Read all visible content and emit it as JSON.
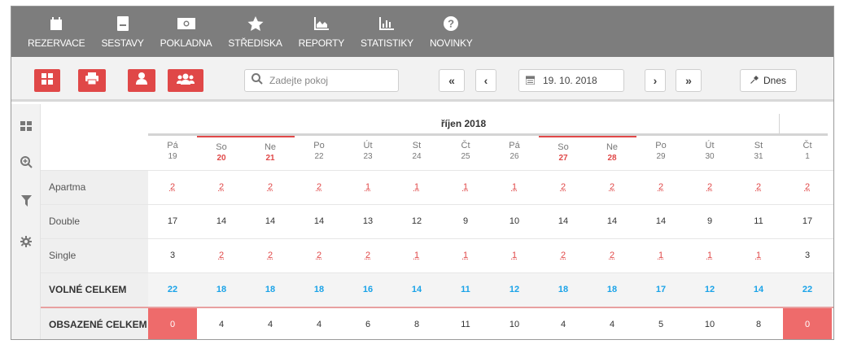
{
  "nav": [
    {
      "label": "REZERVACE",
      "icon": "calendar-icon"
    },
    {
      "label": "SESTAVY",
      "icon": "report-sheet-icon"
    },
    {
      "label": "POKLADNA",
      "icon": "cash-icon"
    },
    {
      "label": "STŘEDISKA",
      "icon": "star-icon"
    },
    {
      "label": "REPORTY",
      "icon": "area-chart-icon"
    },
    {
      "label": "STATISTIKY",
      "icon": "bar-chart-icon"
    },
    {
      "label": "NOVINKY",
      "icon": "question-icon"
    }
  ],
  "toolbar": {
    "search_placeholder": "Zadejte pokoj",
    "date_value": "19. 10. 2018",
    "today_label": "Dnes",
    "first_label": "«",
    "prev_label": "‹",
    "next_label": "›",
    "last_label": "»"
  },
  "grid": {
    "month": "říjen 2018",
    "days": [
      {
        "name": "Pá",
        "num": "19",
        "weekend": false
      },
      {
        "name": "So",
        "num": "20",
        "weekend": true
      },
      {
        "name": "Ne",
        "num": "21",
        "weekend": true
      },
      {
        "name": "Po",
        "num": "22",
        "weekend": false
      },
      {
        "name": "Út",
        "num": "23",
        "weekend": false
      },
      {
        "name": "St",
        "num": "24",
        "weekend": false
      },
      {
        "name": "Čt",
        "num": "25",
        "weekend": false
      },
      {
        "name": "Pá",
        "num": "26",
        "weekend": false
      },
      {
        "name": "So",
        "num": "27",
        "weekend": true
      },
      {
        "name": "Ne",
        "num": "28",
        "weekend": true
      },
      {
        "name": "Po",
        "num": "29",
        "weekend": false
      },
      {
        "name": "Út",
        "num": "30",
        "weekend": false
      },
      {
        "name": "St",
        "num": "31",
        "weekend": false
      },
      {
        "name": "Čt",
        "num": "1",
        "weekend": false
      }
    ],
    "rows": [
      {
        "label": "Apartma",
        "style": "red",
        "values": [
          "2",
          "2",
          "2",
          "2",
          "1",
          "1",
          "1",
          "1",
          "2",
          "2",
          "2",
          "2",
          "2",
          "2"
        ]
      },
      {
        "label": "Double",
        "style": "plain",
        "values": [
          "17",
          "14",
          "14",
          "14",
          "13",
          "12",
          "9",
          "10",
          "14",
          "14",
          "14",
          "9",
          "11",
          "17"
        ]
      },
      {
        "label": "Single",
        "style": "mixed",
        "values": [
          "3",
          "2",
          "2",
          "2",
          "2",
          "1",
          "1",
          "1",
          "2",
          "2",
          "1",
          "1",
          "1",
          "3"
        ],
        "red_mask": [
          false,
          true,
          true,
          true,
          true,
          true,
          true,
          true,
          true,
          true,
          true,
          true,
          true,
          false
        ]
      },
      {
        "label": "VOLNÉ CELKEM",
        "style": "blue",
        "values": [
          "22",
          "18",
          "18",
          "18",
          "16",
          "14",
          "11",
          "12",
          "18",
          "18",
          "17",
          "12",
          "14",
          "22"
        ]
      },
      {
        "label": "OBSAZENÉ CELKEM",
        "style": "occ",
        "values": [
          "0",
          "4",
          "4",
          "4",
          "6",
          "8",
          "11",
          "10",
          "4",
          "4",
          "5",
          "10",
          "8",
          "0"
        ]
      }
    ]
  },
  "colors": {
    "accent": "#e04848",
    "blue": "#1aa3e8",
    "nav_bg": "#7d7d7d"
  }
}
